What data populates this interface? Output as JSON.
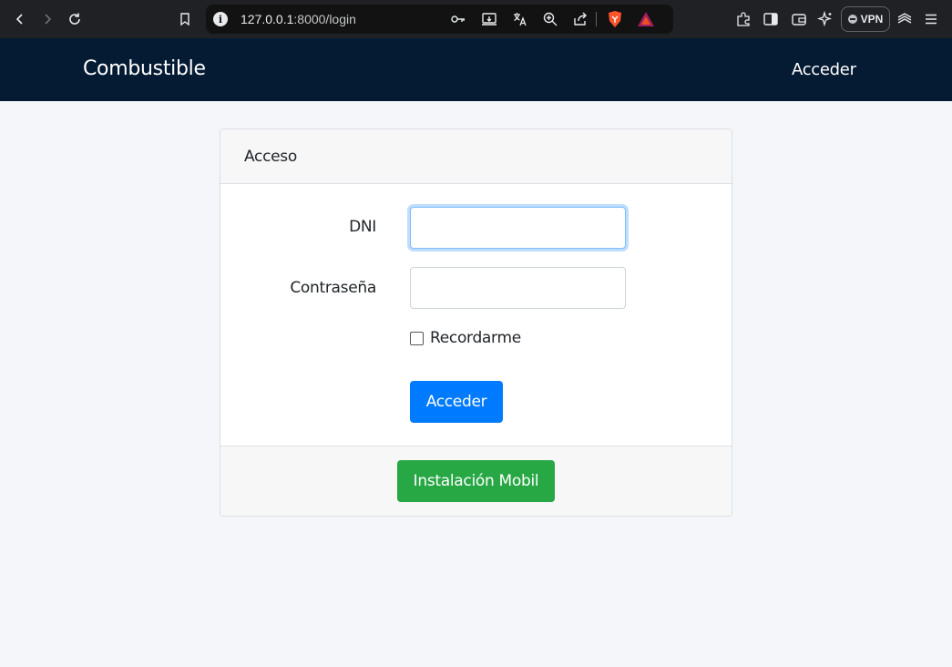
{
  "browser": {
    "url_host": "127.0.0.1",
    "url_rest": ":8000/login",
    "vpn_label": "VPN",
    "icons": [
      "back-icon",
      "forward-icon",
      "reload-icon",
      "bookmark-icon",
      "site-info-icon",
      "password-key-icon",
      "install-app-icon",
      "translate-icon",
      "zoom-icon",
      "share-icon",
      "brave-shields-icon",
      "brave-rewards-icon",
      "extensions-icon",
      "sidebar-icon",
      "wallet-icon",
      "leo-ai-icon",
      "menu-icon"
    ]
  },
  "navbar": {
    "brand": "Combustible",
    "login_link": "Acceder",
    "background": "#051a33"
  },
  "card": {
    "header": "Acceso",
    "dni_label": "DNI",
    "dni_value": "",
    "password_label": "Contraseña",
    "password_value": "",
    "remember_label": "Recordarme",
    "remember_checked": false,
    "submit_label": "Acceder",
    "install_label": "Instalación Mobil"
  },
  "colors": {
    "primary": "#007bff",
    "success": "#28a745",
    "page_bg": "#f4f6f9"
  }
}
